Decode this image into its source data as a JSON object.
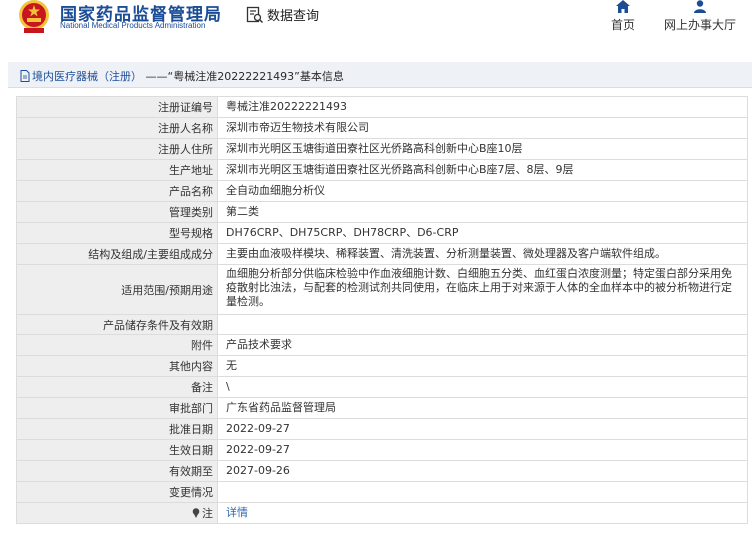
{
  "header": {
    "brand_cn": "国家药品监督管理局",
    "brand_en": "National Medical Products Administration",
    "query_label": "数据查询",
    "nav": [
      {
        "label": "首页",
        "icon": "home-icon"
      },
      {
        "label": "网上办事大厅",
        "icon": "person-icon"
      }
    ]
  },
  "breadcrumb": {
    "section": "境内医疗器械（注册）",
    "separator": "——",
    "title": "“粤械注准20222221493”基本信息"
  },
  "colors": {
    "brand": "#1b4c96",
    "link": "#2d68b4",
    "label_bg": "#eeeeee",
    "emblem_red": "#c8161d",
    "emblem_gold": "#f3c43a"
  },
  "rows": [
    {
      "label": "注册证编号",
      "value": "粤械注准20222221493"
    },
    {
      "label": "注册人名称",
      "value": "深圳市帝迈生物技术有限公司"
    },
    {
      "label": "注册人住所",
      "value": "深圳市光明区玉塘街道田寮社区光侨路高科创新中心B座10层"
    },
    {
      "label": "生产地址",
      "value": "深圳市光明区玉塘街道田寮社区光侨路高科创新中心B座7层、8层、9层"
    },
    {
      "label": "产品名称",
      "value": "全自动血细胞分析仪"
    },
    {
      "label": "管理类别",
      "value": "第二类"
    },
    {
      "label": "型号规格",
      "value": "DH76CRP、DH75CRP、DH78CRP、D6-CRP"
    },
    {
      "label": "结构及组成/主要组成成分",
      "value": "主要由血液吸样模块、稀释装置、清洗装置、分析测量装置、微处理器及客户端软件组成。"
    },
    {
      "label": "适用范围/预期用途",
      "value": "血细胞分析部分供临床检验中作血液细胞计数、白细胞五分类、血红蛋白浓度测量；特定蛋白部分采用免疫散射比浊法，与配套的检测试剂共同使用，在临床上用于对来源于人体的全血样本中的被分析物进行定量检测。"
    },
    {
      "label": "产品储存条件及有效期",
      "value": ""
    },
    {
      "label": "附件",
      "value": "产品技术要求"
    },
    {
      "label": "其他内容",
      "value": "无"
    },
    {
      "label": "备注",
      "value": "\\"
    },
    {
      "label": "审批部门",
      "value": "广东省药品监督管理局"
    },
    {
      "label": "批准日期",
      "value": "2022-09-27"
    },
    {
      "label": "生效日期",
      "value": "2022-09-27"
    },
    {
      "label": "有效期至",
      "value": "2027-09-26"
    },
    {
      "label": "变更情况",
      "value": ""
    },
    {
      "label": "注",
      "value": "详情"
    }
  ]
}
